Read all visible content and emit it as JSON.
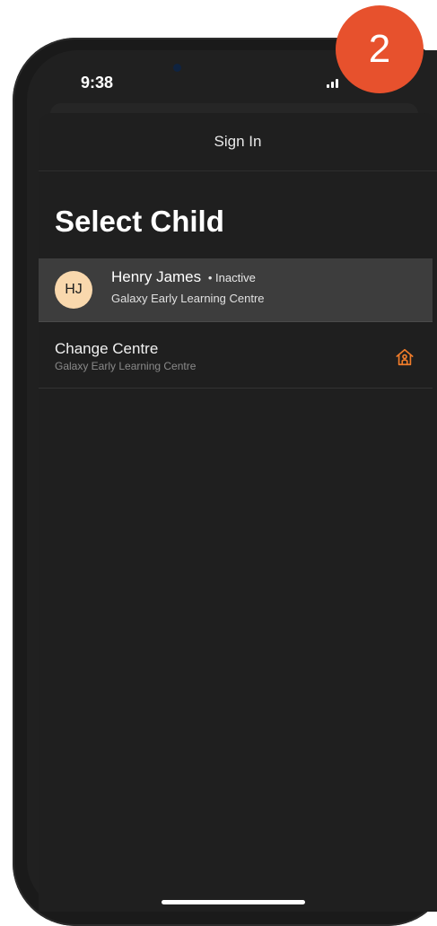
{
  "status_bar": {
    "time": "9:38"
  },
  "step_badge": "2",
  "header": {
    "title": "Sign In"
  },
  "page": {
    "title": "Select Child"
  },
  "children": [
    {
      "initials": "HJ",
      "name": "Henry James",
      "status": "• Inactive",
      "centre": "Galaxy Early Learning Centre"
    }
  ],
  "change_centre": {
    "title": "Change Centre",
    "subtitle": "Galaxy Early Learning Centre",
    "icon": "home-icon"
  },
  "colors": {
    "accent": "#e7512d",
    "icon_orange": "#f07c2a",
    "avatar_bg": "#f9d8ad",
    "selected_row": "#3d3d3d"
  }
}
